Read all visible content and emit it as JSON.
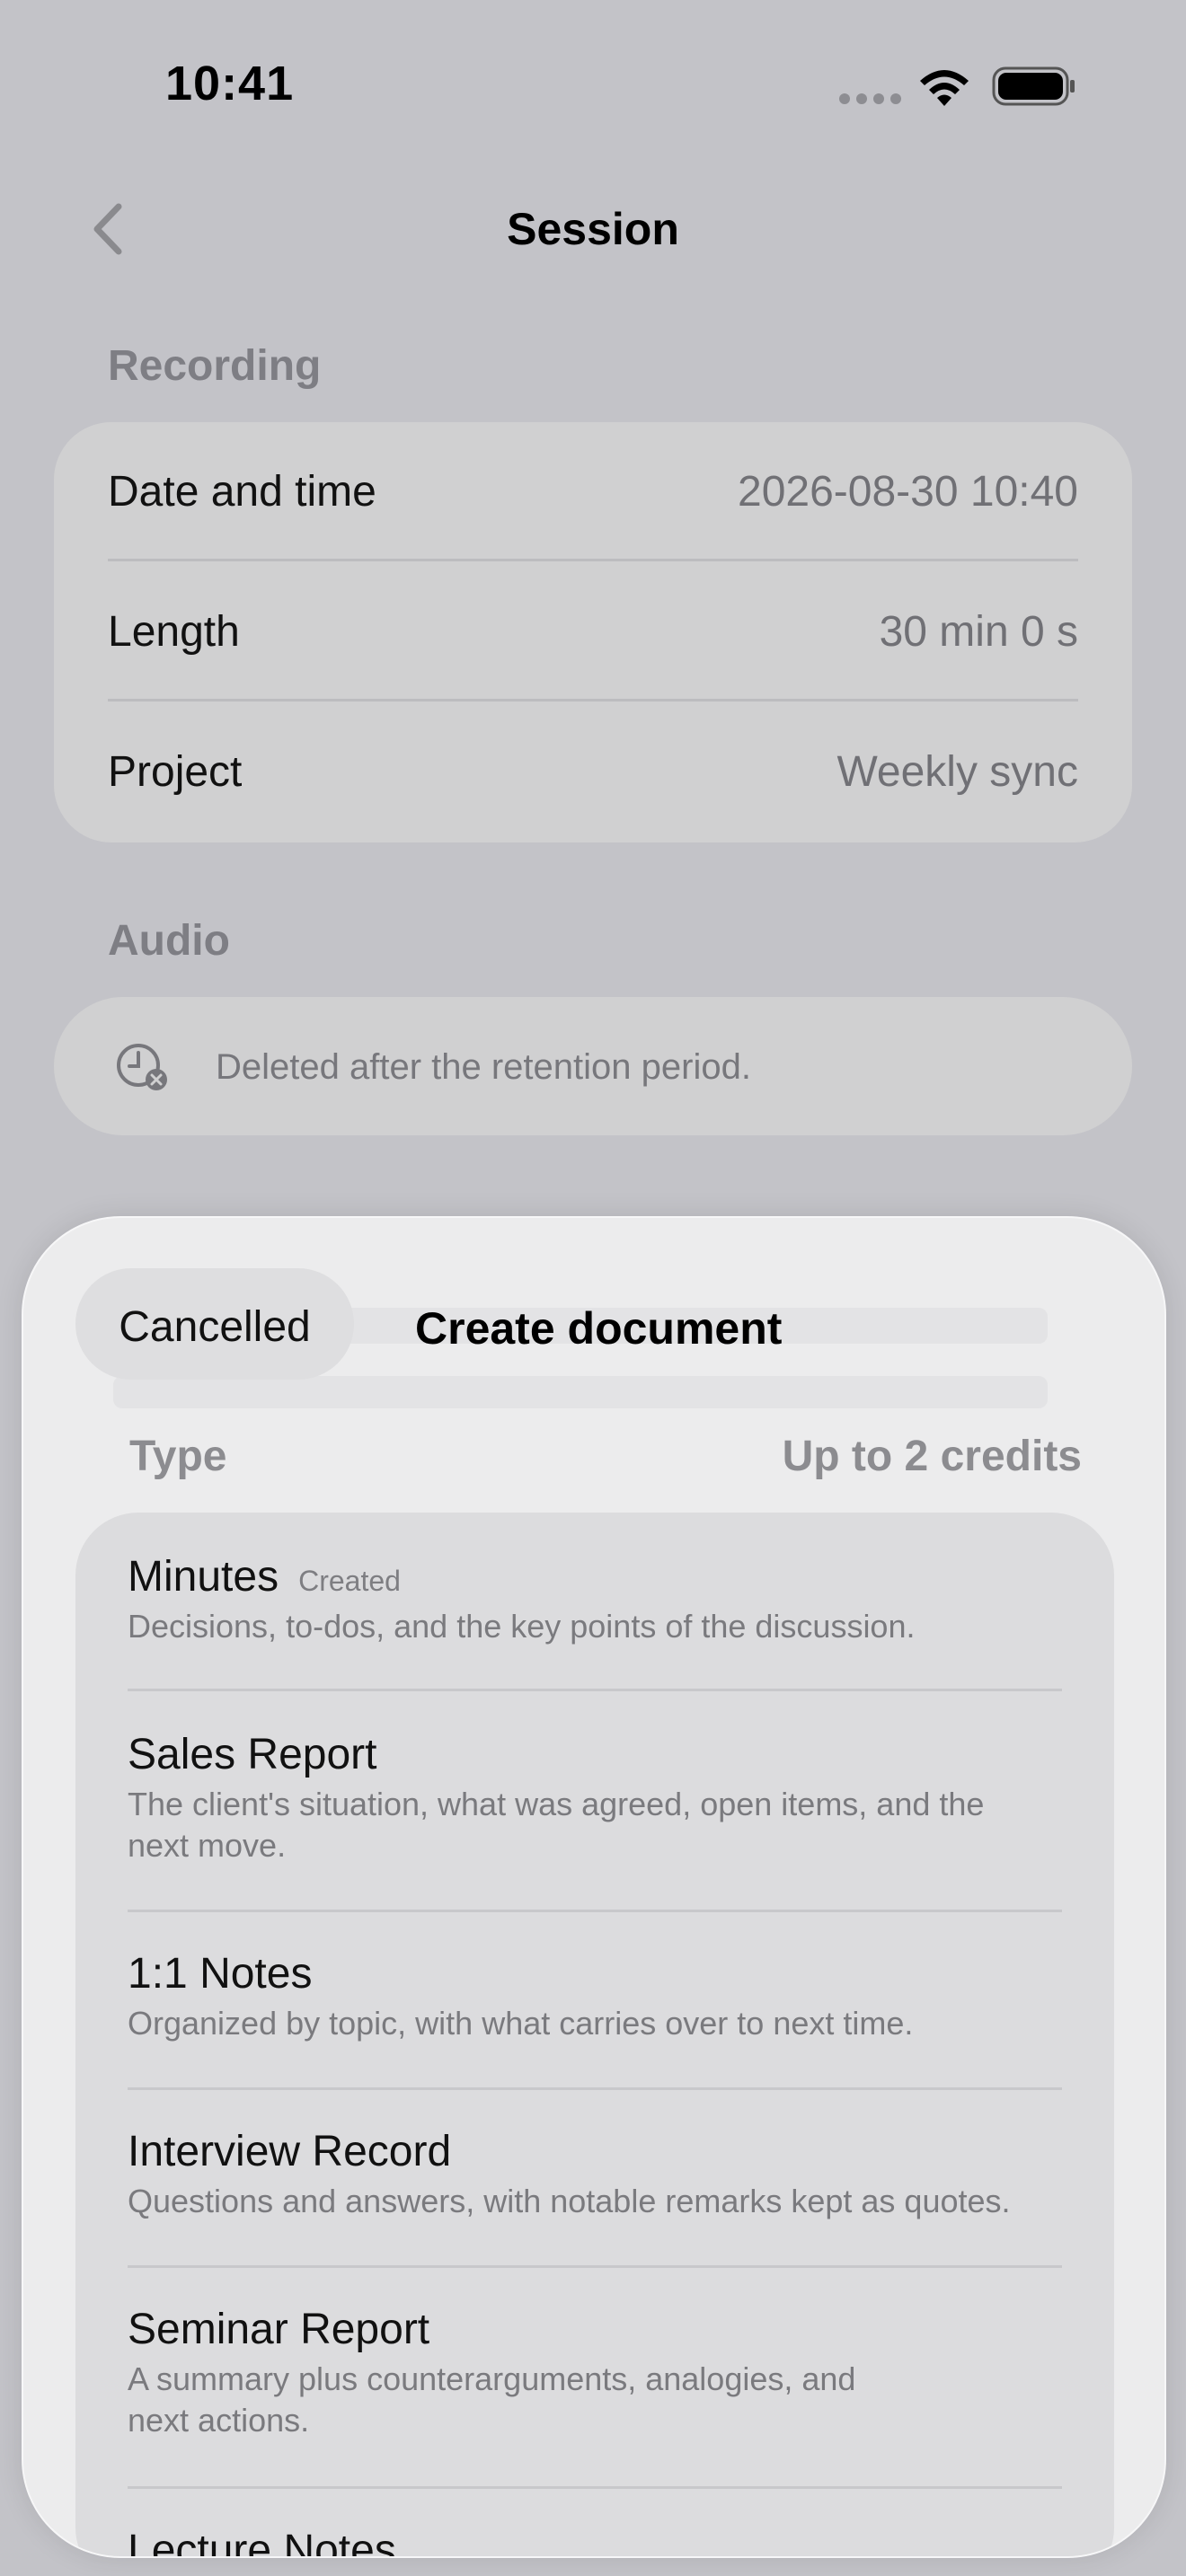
{
  "status": {
    "time": "10:41"
  },
  "nav": {
    "title": "Session"
  },
  "recording": {
    "section_title": "Recording",
    "rows": [
      {
        "label": "Date and time",
        "value": "2026-08-30 10:40"
      },
      {
        "label": "Length",
        "value": "30 min 0 s"
      },
      {
        "label": "Project",
        "value": "Weekly sync"
      }
    ]
  },
  "audio": {
    "section_title": "Audio",
    "notice": "Deleted after the retention period."
  },
  "sheet": {
    "cancel_label": "Cancelled",
    "title": "Create document",
    "type_label": "Type",
    "credits_label": "Up to 2 credits",
    "items": [
      {
        "name": "Minutes",
        "tag": "Created",
        "desc": "Decisions, to-dos, and the key points of the discussion."
      },
      {
        "name": "Sales Report",
        "desc": "The client's situation, what was agreed, open items, and the next move."
      },
      {
        "name": "1:1 Notes",
        "desc": "Organized by topic, with what carries over to next time."
      },
      {
        "name": "Interview Record",
        "desc": "Questions and answers, with notable remarks kept as quotes."
      },
      {
        "name": "Seminar Report",
        "desc": "A summary plus counterarguments, analogies, and next actions."
      },
      {
        "name": "Lecture Notes"
      }
    ]
  },
  "colors": {
    "background": "#c3c3c8",
    "card": "#d0d0d1",
    "sheet": "#ececed",
    "secondary_text": "#707075"
  }
}
